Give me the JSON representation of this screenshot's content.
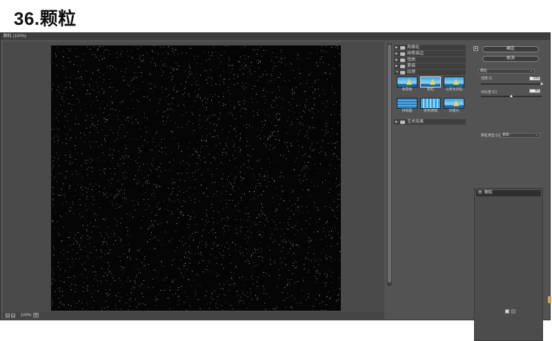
{
  "heading": "36.颗粒",
  "window": {
    "title": "颗粒 (100%)"
  },
  "preview": {
    "zoom": "100%",
    "zoom_dropdown": "v"
  },
  "gallery": {
    "folders": [
      {
        "label": "风格化",
        "state": "collapsed"
      },
      {
        "label": "画笔描边",
        "state": "collapsed"
      },
      {
        "label": "扭曲",
        "state": "collapsed"
      },
      {
        "label": "素描",
        "state": "collapsed"
      },
      {
        "label": "纹理",
        "state": "expanded"
      }
    ],
    "texture_filters": [
      {
        "label": "龟裂缝"
      },
      {
        "label": "颗粒"
      },
      {
        "label": "马赛克拼贴"
      },
      {
        "label": "拼缀图"
      },
      {
        "label": "染色玻璃"
      },
      {
        "label": "纹理化"
      }
    ],
    "selected_filter": "颗粒",
    "last_folder": {
      "label": "艺术效果",
      "state": "collapsed"
    }
  },
  "controls": {
    "ok_label": "确定",
    "cancel_label": "取消",
    "filter_select": "颗粒",
    "intensity_label": "强度 (I)",
    "intensity_value": "100",
    "intensity_fraction": 1.0,
    "contrast_label": "对比度 (C)",
    "contrast_value": "50",
    "contrast_fraction": 0.5,
    "grain_type_label": "颗粒类型 (G):",
    "grain_type_value": "柔和"
  },
  "layers": {
    "items": [
      {
        "label": "颗粒"
      }
    ]
  },
  "icons": {
    "eye": "eye-icon",
    "folder": "folder-icon",
    "new_layer": "new-effect-layer-icon",
    "delete": "delete-effect-layer-icon"
  },
  "colors": {
    "panel": "#535353",
    "preview": "#050505",
    "accent_text": "#e0e0e0"
  }
}
